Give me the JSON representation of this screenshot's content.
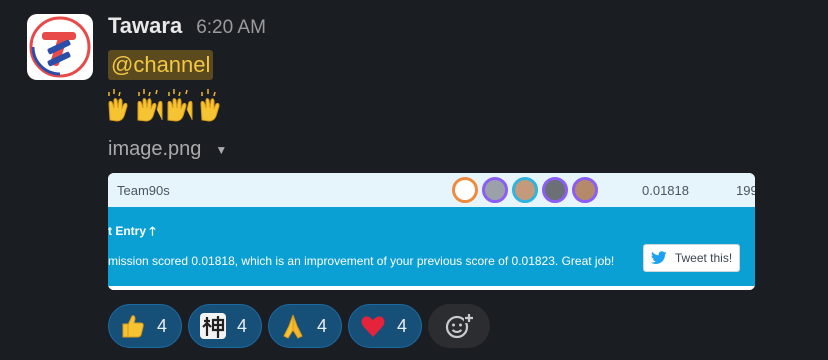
{
  "message": {
    "author": "Tawara",
    "time": "6:20 AM",
    "mention": "@channel",
    "file_name": "image.png"
  },
  "preview": {
    "team": "Team90s",
    "score": "0.01818",
    "rank": "199",
    "entry_title": "t Entry 🡑",
    "entry_message": "mission scored 0.01818, which is an improvement of your previous score of 0.01823. Great job!",
    "tweet_label": "Tweet this!"
  },
  "reactions": [
    {
      "emoji": "thumbs-up",
      "count": "4"
    },
    {
      "emoji": "kami",
      "count": "4"
    },
    {
      "emoji": "folded-hands",
      "count": "4"
    },
    {
      "emoji": "heart",
      "count": "4"
    }
  ],
  "colors": {
    "background": "#1a1d21",
    "mention_bg": "#5b4a1e",
    "mention_text": "#f2c744",
    "reaction_bg": "#164f78",
    "banner_blue": "#0ba0d4"
  }
}
